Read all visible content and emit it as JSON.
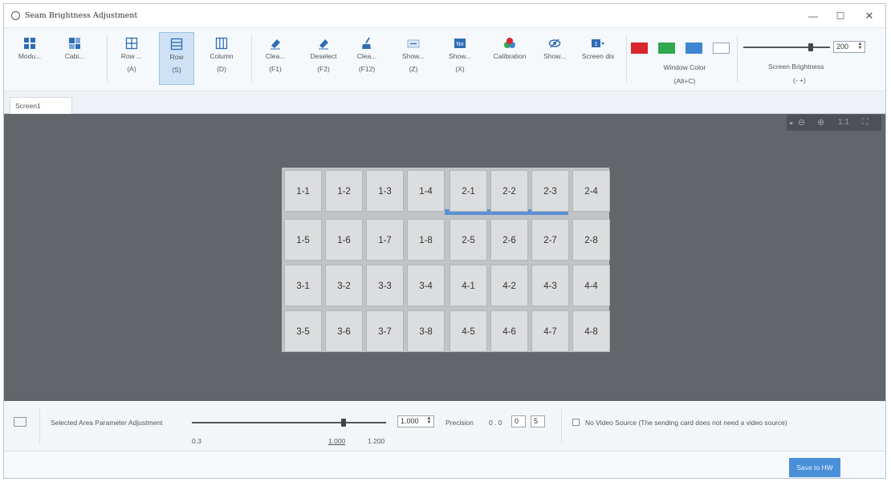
{
  "window": {
    "title": "Seam Brightness Adjustment",
    "controls": {
      "minimize": "—",
      "maximize": "☐",
      "close": "✕"
    }
  },
  "toolbar": {
    "buttons": [
      {
        "label": "Modu...",
        "key": "",
        "icon": "module-icon"
      },
      {
        "label": "Cabi...",
        "key": "",
        "icon": "cabinet-icon"
      },
      {
        "label": "Row ...",
        "key": "(A)",
        "icon": "row-grid-icon"
      },
      {
        "label": "Row",
        "key": "(S)",
        "icon": "row-icon",
        "active": true
      },
      {
        "label": "Column",
        "key": "(D)",
        "icon": "column-icon"
      },
      {
        "label": "Clea...",
        "key": "(F1)",
        "icon": "eraser-icon"
      },
      {
        "label": "Deselect",
        "key": "(F2)",
        "icon": "deselect-icon"
      },
      {
        "label": "Clea...",
        "key": "(F12)",
        "icon": "broom-icon"
      },
      {
        "label": "Show...",
        "key": "(Z)",
        "icon": "show-icon"
      },
      {
        "label": "Show...",
        "key": "(X)",
        "icon": "no-icon"
      },
      {
        "label": "Calibration",
        "key": "",
        "icon": "calibration-icon"
      },
      {
        "label": "Show...",
        "key": "",
        "icon": "eye-icon"
      },
      {
        "label": "Screen dis",
        "key": "",
        "icon": "screen-display-icon"
      }
    ],
    "window_color": {
      "label": "Window Color",
      "key": "(Alt+C)",
      "swatches": [
        "#d9262d",
        "#2fa84f",
        "#3d86d1",
        "#ffffff"
      ]
    },
    "screen_brightness": {
      "label": "Screen Brightness",
      "key": "(-  +)",
      "value": "200",
      "level": 0.78
    }
  },
  "tabs": [
    {
      "label": "Screen1"
    }
  ],
  "canvas": {
    "zoom_controls": [
      "▸",
      "⊖",
      "⊕",
      "1:1",
      "⛶"
    ],
    "rows": [
      [
        "1-1",
        "1-2",
        "1-3",
        "1-4",
        "2-1",
        "2-2",
        "2-3",
        "2-4"
      ],
      [
        "1-5",
        "1-6",
        "1-7",
        "1-8",
        "2-5",
        "2-6",
        "2-7",
        "2-8"
      ],
      [
        "3-1",
        "3-2",
        "3-3",
        "3-4",
        "4-1",
        "4-2",
        "4-3",
        "4-4"
      ],
      [
        "3-5",
        "3-6",
        "3-7",
        "3-8",
        "4-5",
        "4-6",
        "4-7",
        "4-8"
      ]
    ]
  },
  "param": {
    "label": "Selected Area Parameter Adjustment",
    "min": "0.3",
    "mid": "1.000",
    "max": "1.200",
    "value": "1.000",
    "level": 0.78,
    "precision_label": "Precision",
    "precision_prefix": "0 . 0",
    "precision_digits": [
      "0",
      "5"
    ],
    "no_video_label": "No Video Source (The sending card does not need a video source)"
  },
  "footer": {
    "save_label": "Save to HW"
  }
}
